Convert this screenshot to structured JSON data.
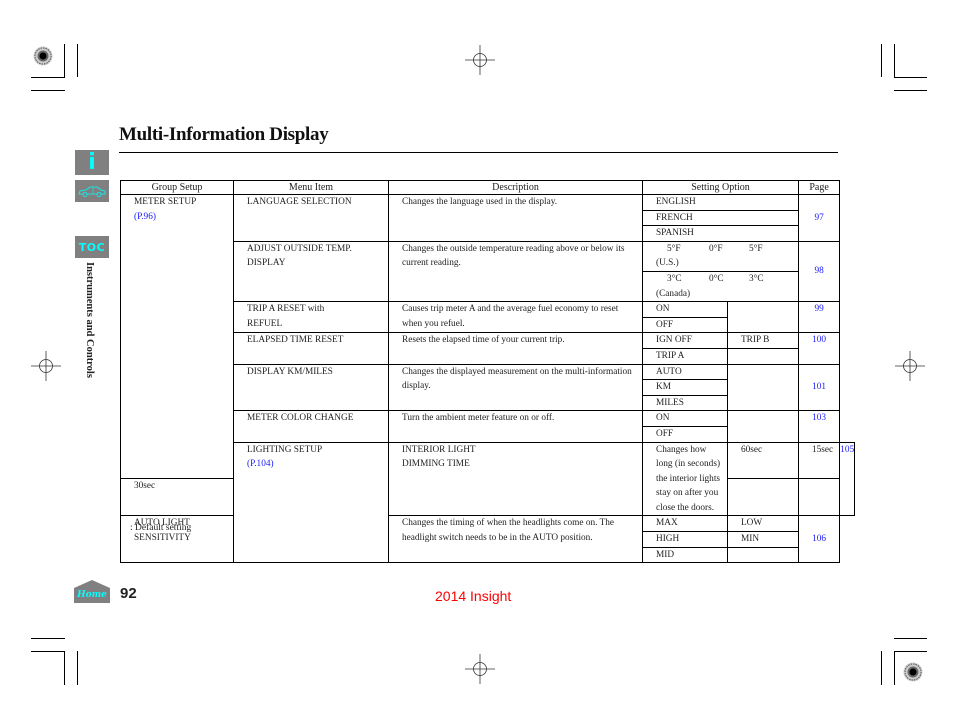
{
  "page": {
    "title": "Multi-Information Display",
    "section_label": "Instruments and Controls",
    "page_number": "92",
    "edition": "2014 Insight",
    "footnote": ": Default setting",
    "link_color": "#1a1aff",
    "accent_color": "#00ffff",
    "edition_color": "#ff0000"
  },
  "sidebar": {
    "info_label": "i",
    "toc_label": "TOC",
    "home_label": "Home"
  },
  "table": {
    "headers": [
      "Group Setup",
      "Menu Item",
      "Description",
      "Setting Option",
      "Page"
    ],
    "groups": [
      {
        "name": "METER SETUP",
        "ref": "(P.96)"
      },
      {
        "name": "LIGHTING SETUP",
        "ref": "(P.104)"
      }
    ],
    "rows": [
      {
        "menu_item": [
          "LANGUAGE SELECTION"
        ],
        "description": "Changes the language used in the display.",
        "options": [
          "ENGLISH",
          "FRENCH",
          "SPANISH"
        ],
        "page": "97"
      },
      {
        "menu_item": [
          "ADJUST OUTSIDE TEMP.",
          "DISPLAY"
        ],
        "description": "Changes the outside temperature reading above or below its current reading.",
        "options_us": [
          "5°F",
          "0°F",
          "5°F"
        ],
        "us_label": "(U.S.)",
        "options_ca": [
          "3°C",
          "0°C",
          "3°C"
        ],
        "ca_label": "(Canada)",
        "page": "98"
      },
      {
        "menu_item": [
          "TRIP A RESET with",
          "REFUEL"
        ],
        "description": "Causes trip meter A and the average fuel economy to reset when you refuel.",
        "options": [
          "ON",
          "OFF"
        ],
        "page": "99"
      },
      {
        "menu_item": [
          "ELAPSED TIME RESET"
        ],
        "description": "Resets the elapsed time of your current trip.",
        "options": [
          "IGN OFF",
          "TRIP A"
        ],
        "options_col2": [
          "TRIP B"
        ],
        "page": "100"
      },
      {
        "menu_item": [
          "DISPLAY KM/MILES"
        ],
        "description": "Changes the displayed measurement on the multi-information display.",
        "options": [
          "AUTO",
          "KM",
          "MILES"
        ],
        "page": "101"
      },
      {
        "menu_item": [
          "METER COLOR CHANGE"
        ],
        "description": "Turn the ambient meter feature on or off.",
        "options": [
          "ON",
          "OFF"
        ],
        "page": "103"
      },
      {
        "menu_item": [
          "INTERIOR LIGHT",
          "DIMMING TIME"
        ],
        "description": "Changes how long (in seconds) the interior lights stay on after you close the doors.",
        "options": [
          "60sec",
          "30sec"
        ],
        "options_col2": [
          "15sec"
        ],
        "page": "105"
      },
      {
        "menu_item": [
          "AUTO LIGHT",
          "SENSITIVITY"
        ],
        "description": "Changes the timing of when the headlights come on. The headlight switch needs to be in the AUTO position.",
        "options": [
          "MAX",
          "HIGH",
          "MID"
        ],
        "options_col2": [
          "LOW",
          "MIN"
        ],
        "page": "106"
      }
    ]
  }
}
